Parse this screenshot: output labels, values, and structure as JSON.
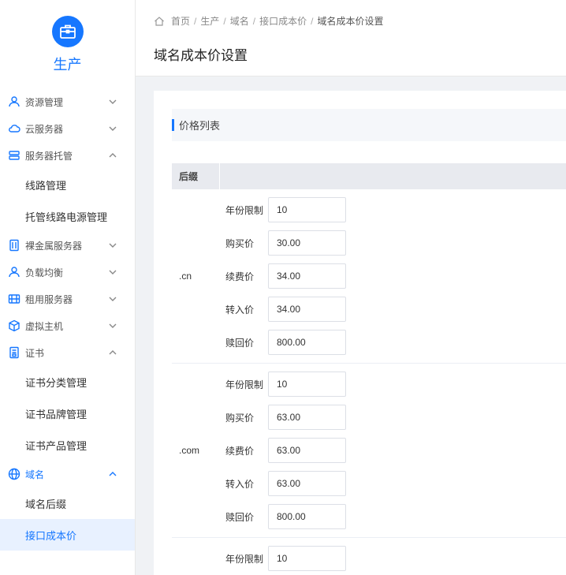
{
  "brand": {
    "title": "生产"
  },
  "sidebar": {
    "items": [
      {
        "label": "资源管理",
        "icon": "users-icon"
      },
      {
        "label": "云服务器",
        "icon": "cloud-icon"
      },
      {
        "label": "服务器托管",
        "icon": "server-icon"
      },
      {
        "label": "线路管理"
      },
      {
        "label": "托管线路电源管理"
      },
      {
        "label": "裸金属服务器",
        "icon": "rack-icon"
      },
      {
        "label": "负载均衡",
        "icon": "balance-icon"
      },
      {
        "label": "租用服务器",
        "icon": "server-stack-icon"
      },
      {
        "label": "虚拟主机",
        "icon": "cube-icon"
      },
      {
        "label": "证书",
        "icon": "certificate-icon"
      },
      {
        "label": "证书分类管理"
      },
      {
        "label": "证书品牌管理"
      },
      {
        "label": "证书产品管理"
      },
      {
        "label": "域名",
        "icon": "globe-icon"
      },
      {
        "label": "域名后缀"
      },
      {
        "label": "接口成本价"
      }
    ]
  },
  "breadcrumb": [
    "首页",
    "生产",
    "域名",
    "接口成本价",
    "域名成本价设置"
  ],
  "page": {
    "title": "域名成本价设置"
  },
  "section": {
    "title": "价格列表"
  },
  "table": {
    "header_suffix": "后缀",
    "labels": [
      "年份限制",
      "购买价",
      "续费价",
      "转入价",
      "赎回价"
    ],
    "groups": [
      {
        "suffix": ".cn",
        "values": [
          "10",
          "30.00",
          "34.00",
          "34.00",
          "800.00"
        ]
      },
      {
        "suffix": ".com",
        "values": [
          "10",
          "63.00",
          "63.00",
          "63.00",
          "800.00"
        ]
      },
      {
        "suffix": "",
        "values": [
          "10"
        ]
      }
    ]
  },
  "colors": {
    "accent": "#1677ff",
    "active_bg": "#e8f1ff"
  }
}
